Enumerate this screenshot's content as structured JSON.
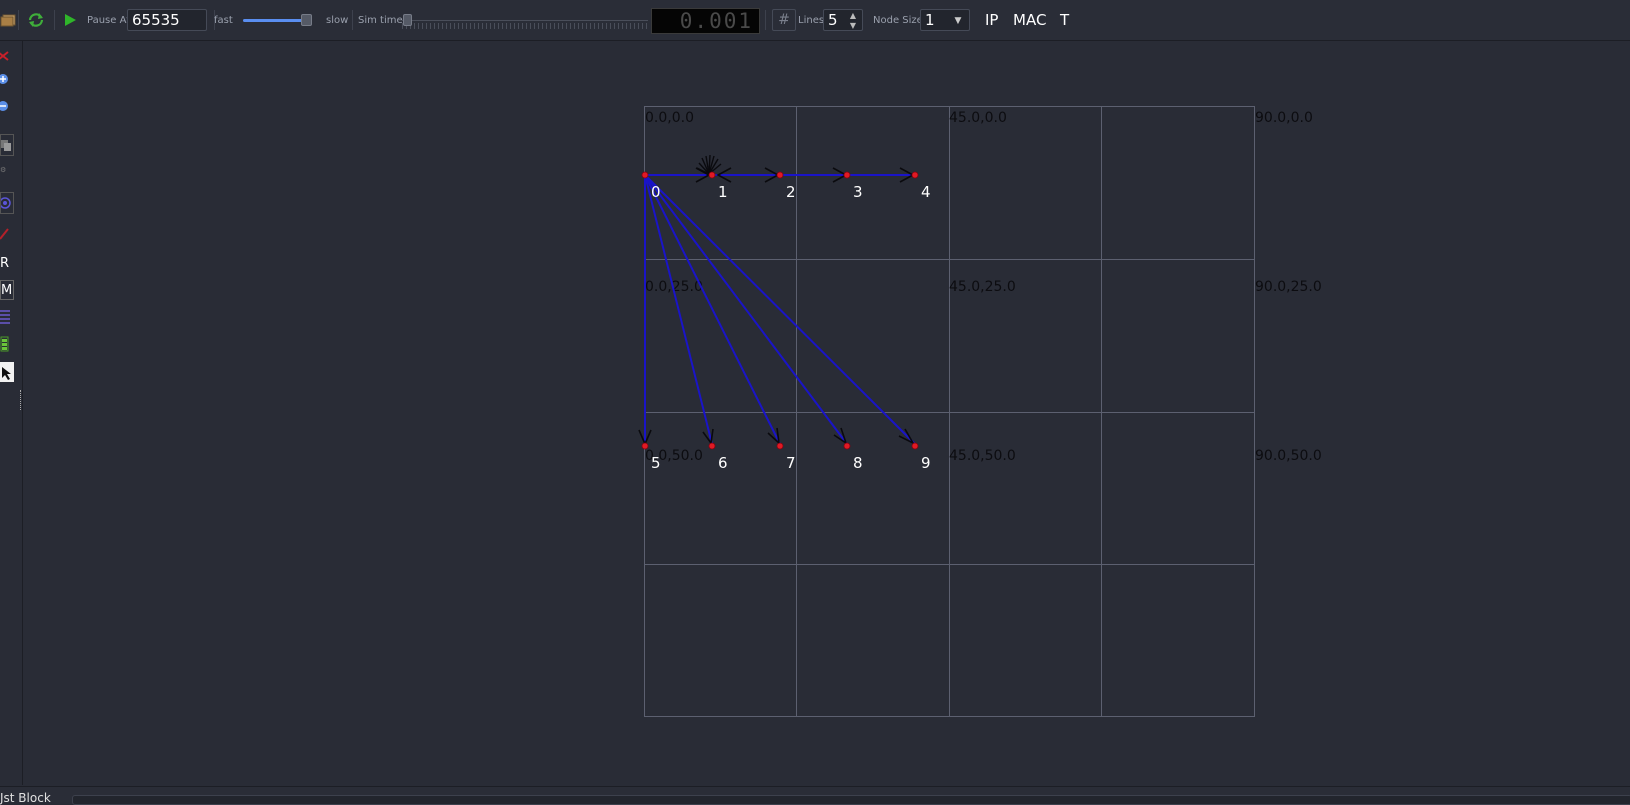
{
  "toolbar": {
    "pause_at_label": "Pause At",
    "pause_at_value": "65535",
    "fast_label": "fast",
    "slow_label": "slow",
    "sim_time_label": "Sim time",
    "sim_time_display": "0.001",
    "lines_label": "Lines",
    "lines_value": "5",
    "node_size_label": "Node Size",
    "node_size_value": "1",
    "ip_label": "IP",
    "mac_label": "MAC",
    "t_label": "T"
  },
  "sidebar": {
    "r_label": "R",
    "m_label": "M"
  },
  "bottom": {
    "label": "Jst Block"
  },
  "canvas": {
    "coords": {
      "r0": [
        "0.0,0.0",
        "45.0,0.0",
        "90.0,0.0"
      ],
      "r1": [
        "0.0,25.0",
        "45.0,25.0",
        "90.0,25.0"
      ],
      "r2": [
        "0.0,50.0",
        "45.0,50.0",
        "90.0,50.0"
      ]
    },
    "node_ids": [
      "0",
      "1",
      "2",
      "3",
      "4",
      "5",
      "6",
      "7",
      "8",
      "9"
    ]
  },
  "colors": {
    "background": "#292c36",
    "link": "#1a14c8",
    "node": "#e01b24",
    "grid": "#5c6070"
  }
}
